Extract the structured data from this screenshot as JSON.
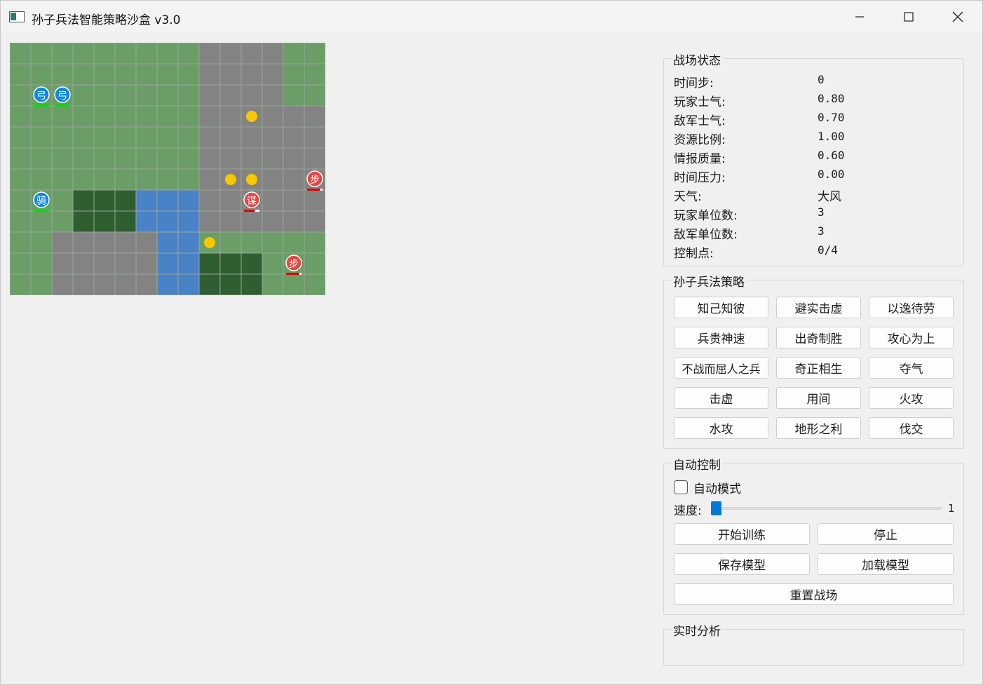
{
  "window": {
    "title": "孙子兵法智能策略沙盒 v3.0"
  },
  "board": {
    "cols": 15,
    "rows": 12,
    "terrain_legend": {
      "G": "#6a9e66",
      "R": "#838383",
      "F": "#2f5e30",
      "W": "#4a82c8"
    },
    "terrain": [
      "GGGGGGGGGRRRRGG",
      "GGGGGGGGGRRRRGG",
      "GGGGGGGGGRRRRGG",
      "GGGGGGGGGRRRRRR",
      "GGGGGGGGGRRRRRR",
      "GGGGGGGGGRRRRRR",
      "GGGGGGGGGRRRRRR",
      "GGGFFFWWWRRRRRR",
      "GGGFFFWWWRRRRRR",
      "GGRRRRRWWGGGGGG",
      "GGRRRRRWWFFFGGG",
      "GGRRRRRWWFFFGGG"
    ],
    "grid_color": "#9aa59a",
    "resources": [
      {
        "col": 11,
        "row": 3
      },
      {
        "col": 10,
        "row": 6
      },
      {
        "col": 11,
        "row": 6
      },
      {
        "col": 9,
        "row": 9
      }
    ],
    "resource_color": "#f5c800",
    "units": [
      {
        "side": "player",
        "label": "弓",
        "col": 1,
        "row": 2,
        "health": 1.0
      },
      {
        "side": "player",
        "label": "弓",
        "col": 2,
        "row": 2,
        "health": 1.0
      },
      {
        "side": "player",
        "label": "骑",
        "col": 1,
        "row": 7,
        "health": 1.0
      },
      {
        "side": "enemy",
        "label": "步",
        "col": 14,
        "row": 6,
        "health": 0.85
      },
      {
        "side": "enemy",
        "label": "谋",
        "col": 11,
        "row": 7,
        "health": 0.7
      },
      {
        "side": "enemy",
        "label": "步",
        "col": 13,
        "row": 10,
        "health": 0.85
      }
    ],
    "player_color": "#1188e8",
    "enemy_color": "#e84444",
    "player_bar_color": "#00e000",
    "enemy_bar_color": "#e00000"
  },
  "status": {
    "title": "战场状态",
    "rows": [
      {
        "label": "时间步:",
        "value": "0"
      },
      {
        "label": "玩家士气:",
        "value": "0.80"
      },
      {
        "label": "敌军士气:",
        "value": "0.70"
      },
      {
        "label": "资源比例:",
        "value": "1.00"
      },
      {
        "label": "情报质量:",
        "value": "0.60"
      },
      {
        "label": "时间压力:",
        "value": "0.00"
      },
      {
        "label": "天气:",
        "value": "大风"
      },
      {
        "label": "玩家单位数:",
        "value": "3"
      },
      {
        "label": "敌军单位数:",
        "value": "3"
      },
      {
        "label": "控制点:",
        "value": "0/4"
      }
    ]
  },
  "strategy": {
    "title": "孙子兵法策略",
    "buttons": [
      "知己知彼",
      "避实击虚",
      "以逸待劳",
      "兵贵神速",
      "出奇制胜",
      "攻心为上",
      "不战而屈人之兵",
      "奇正相生",
      "夺气",
      "击虚",
      "用间",
      "火攻",
      "水攻",
      "地形之利",
      "伐交"
    ]
  },
  "auto": {
    "title": "自动控制",
    "auto_mode_label": "自动模式",
    "auto_mode_checked": false,
    "speed_label": "速度:",
    "speed_value": "1",
    "start_label": "开始训练",
    "stop_label": "停止",
    "save_label": "保存模型",
    "load_label": "加载模型",
    "reset_label": "重置战场"
  },
  "analysis": {
    "title": "实时分析"
  }
}
